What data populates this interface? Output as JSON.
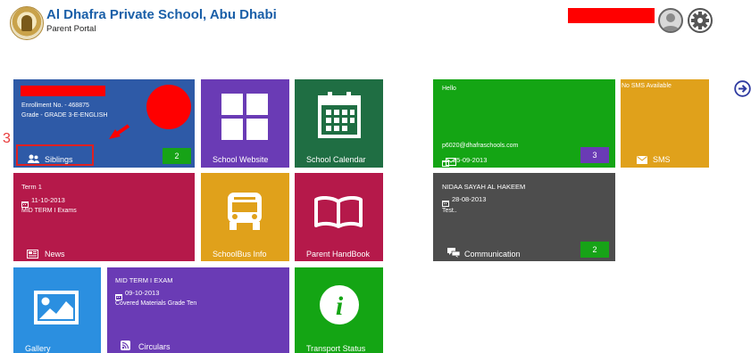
{
  "header": {
    "school_name": "Al Dhafra Private School, Abu Dhabi",
    "subtitle": "Parent Portal",
    "icons": [
      "school-logo",
      "user-icon",
      "gear-icon",
      "arrow-right-icon"
    ]
  },
  "annotation": {
    "step_number": "3"
  },
  "tiles": {
    "student": {
      "enrollment": "Enrollment No. - 468875",
      "grade": "Grade - GRADE 3-E-ENGLISH",
      "label": "Siblings",
      "badge": "2",
      "color": "#2e5aa7"
    },
    "website": {
      "label": "School Website",
      "color": "#6a3bb5"
    },
    "calendar": {
      "label": "School Calendar",
      "color": "#1f6e43"
    },
    "news": {
      "title": "Term 1",
      "date": "11-10-2013",
      "desc": "MID TERM I Exams",
      "label": "News",
      "color": "#b5194a"
    },
    "bus": {
      "label": "SchoolBus Info",
      "color": "#e0a11b"
    },
    "handbook": {
      "label": "Parent HandBook",
      "color": "#b5194a"
    },
    "gallery": {
      "label": "Gallery",
      "color": "#2b8fe0"
    },
    "circulars": {
      "title": "MID TERM I EXAM",
      "date": "09-10-2013",
      "desc": "Covered Materials Grade Ten",
      "label": "Circulars",
      "color": "#6a3bb5"
    },
    "transport": {
      "label": "Transport Status",
      "color": "#14a514"
    },
    "email": {
      "greeting": "Hello",
      "address": "p6020@dhafraschools.com",
      "date": "25-09-2013",
      "badge": "3",
      "color": "#14a514"
    },
    "sms": {
      "status": "No SMS Available",
      "label": "SMS",
      "color": "#e0a11b"
    },
    "communication": {
      "name": "NIDAA SAYAH AL HAKEEM",
      "date": "28-08-2013",
      "text": "Test..",
      "label": "Communication",
      "badge": "2",
      "color": "#4d4d4d"
    }
  }
}
